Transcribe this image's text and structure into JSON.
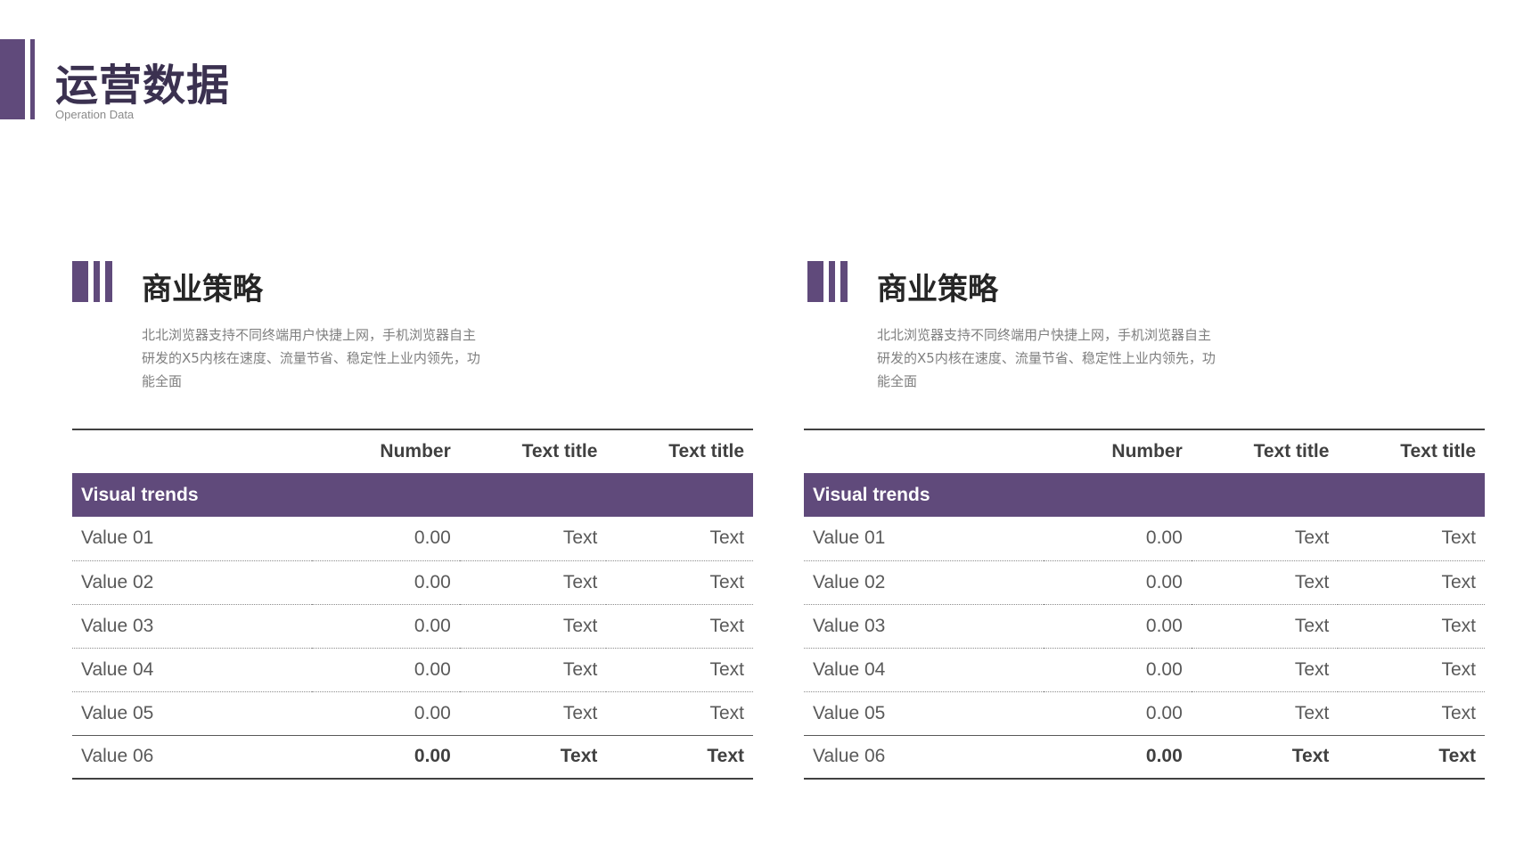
{
  "header": {
    "title": "运营数据",
    "subtitle": "Operation Data"
  },
  "colors": {
    "accent": "#604a7b",
    "title_text": "#3b3150"
  },
  "panels": [
    {
      "heading": "商业策略",
      "description": "北北浏览器支持不同终端用户快捷上网，手机浏览器自主研发的X5内核在速度、流量节省、稳定性上业内领先，功能全面",
      "columns": [
        "",
        "Number",
        "Text title",
        "Text title"
      ],
      "group_label": "Visual trends",
      "rows": [
        {
          "label": "Value 01",
          "number": "0.00",
          "t1": "Text",
          "t2": "Text"
        },
        {
          "label": "Value 02",
          "number": "0.00",
          "t1": "Text",
          "t2": "Text"
        },
        {
          "label": "Value 03",
          "number": "0.00",
          "t1": "Text",
          "t2": "Text"
        },
        {
          "label": "Value 04",
          "number": "0.00",
          "t1": "Text",
          "t2": "Text"
        },
        {
          "label": "Value 05",
          "number": "0.00",
          "t1": "Text",
          "t2": "Text"
        },
        {
          "label": "Value 06",
          "number": "0.00",
          "t1": "Text",
          "t2": "Text"
        }
      ]
    },
    {
      "heading": "商业策略",
      "description": "北北浏览器支持不同终端用户快捷上网，手机浏览器自主研发的X5内核在速度、流量节省、稳定性上业内领先，功能全面",
      "columns": [
        "",
        "Number",
        "Text title",
        "Text title"
      ],
      "group_label": "Visual trends",
      "rows": [
        {
          "label": "Value 01",
          "number": "0.00",
          "t1": "Text",
          "t2": "Text"
        },
        {
          "label": "Value 02",
          "number": "0.00",
          "t1": "Text",
          "t2": "Text"
        },
        {
          "label": "Value 03",
          "number": "0.00",
          "t1": "Text",
          "t2": "Text"
        },
        {
          "label": "Value 04",
          "number": "0.00",
          "t1": "Text",
          "t2": "Text"
        },
        {
          "label": "Value 05",
          "number": "0.00",
          "t1": "Text",
          "t2": "Text"
        },
        {
          "label": "Value 06",
          "number": "0.00",
          "t1": "Text",
          "t2": "Text"
        }
      ]
    }
  ]
}
